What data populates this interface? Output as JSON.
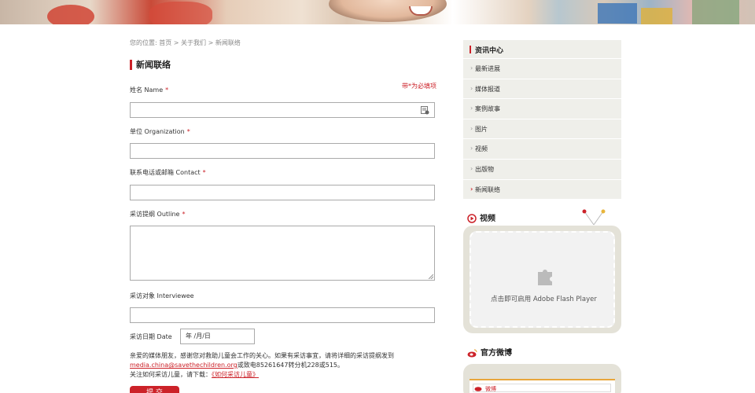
{
  "breadcrumb": "您的位置: 首页 > 关于我们 > 新闻联络",
  "page_title": "新闻联络",
  "required_note": "带*为必填项",
  "form": {
    "name_label": "姓名 Name",
    "org_label": "单位 Organization",
    "contact_label": "联系电话或邮箱 Contact",
    "outline_label": "采访提纲 Outline",
    "interviewee_label": "采访对象 Interviewee",
    "date_label": "采访日期  Date",
    "date_placeholder": "年 /月/日",
    "required_mark": "*"
  },
  "note": {
    "line1": "亲爱的媒体朋友，感谢您对救助儿童会工作的关心。如果有采访事宜，请将详细的采访提纲发到",
    "email": "media.china@savethechildren.org",
    "line2_rest": "或致电85261647转分机228或515。",
    "line3_prefix": "关注如何采访儿童，请下载：",
    "line3_link": "《如何采访儿童》"
  },
  "submit_label": "提 交",
  "sidebar": {
    "title": "资讯中心",
    "items": [
      {
        "label": "最新进展"
      },
      {
        "label": "媒体报道"
      },
      {
        "label": "案例故事"
      },
      {
        "label": "图片"
      },
      {
        "label": "视频"
      },
      {
        "label": "出版物"
      },
      {
        "label": "新闻联络"
      }
    ],
    "active_index": 6
  },
  "video": {
    "title": "视频",
    "flash_text": "点击即可启用 Adobe Flash Player"
  },
  "weibo": {
    "title": "官方微博",
    "tab": "微博"
  },
  "colors": {
    "accent": "#cc2229",
    "sidebar_bg": "#efefea",
    "frame": "#e4e2d8"
  }
}
